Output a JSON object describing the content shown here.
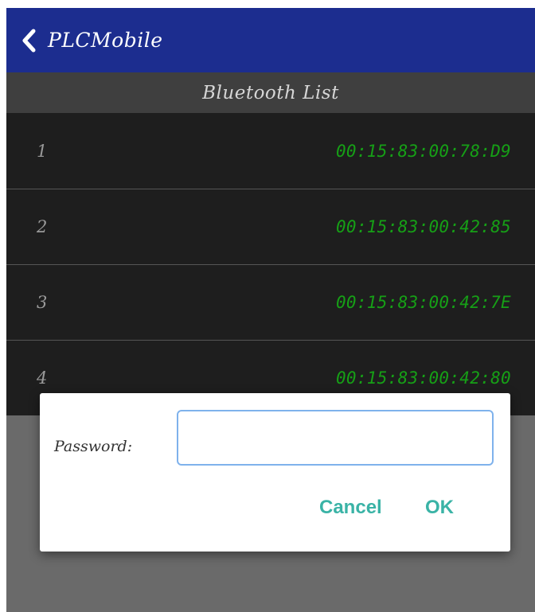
{
  "app_bar": {
    "title": "PLCMobile",
    "back_icon": "chevron-left-icon"
  },
  "list": {
    "header": "Bluetooth List",
    "devices": [
      {
        "index": "1",
        "mac": "00:15:83:00:78:D9"
      },
      {
        "index": "2",
        "mac": "00:15:83:00:42:85"
      },
      {
        "index": "3",
        "mac": "00:15:83:00:42:7E"
      },
      {
        "index": "4",
        "mac": "00:15:83:00:42:80"
      }
    ]
  },
  "dialog": {
    "password_label": "Password:",
    "password_value": "",
    "cancel_label": "Cancel",
    "ok_label": "OK"
  },
  "colors": {
    "app_bar": "#1c2d8f",
    "list_background": "#1e1e1e",
    "header_background": "#3f3f3f",
    "mac_text": "#16a016",
    "dialog_buttons": "#3ab3a6",
    "input_border": "#7fb2ec"
  }
}
